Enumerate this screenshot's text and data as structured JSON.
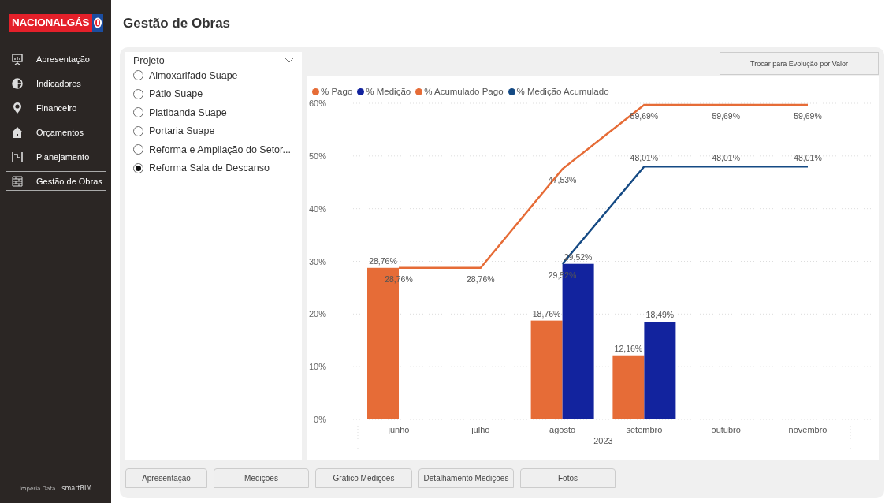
{
  "brand": {
    "name": "NACIONALGÁS"
  },
  "sidebar": {
    "items": [
      {
        "label": "Apresentação",
        "selected": false
      },
      {
        "label": "Indicadores",
        "selected": false
      },
      {
        "label": "Financeiro",
        "selected": false
      },
      {
        "label": "Orçamentos",
        "selected": false
      },
      {
        "label": "Planejamento",
        "selected": false
      },
      {
        "label": "Gestão de Obras",
        "selected": true
      }
    ],
    "footer": [
      "Imperia Data",
      "smartBIM"
    ]
  },
  "page_title": "Gestão de Obras",
  "slicer": {
    "title": "Projeto",
    "options": [
      {
        "label": "Almoxarifado Suape",
        "selected": false
      },
      {
        "label": "Pátio Suape",
        "selected": false
      },
      {
        "label": "Platibanda Suape",
        "selected": false
      },
      {
        "label": "Portaria Suape",
        "selected": false
      },
      {
        "label": "Reforma e Ampliação do Setor...",
        "selected": false
      },
      {
        "label": "Reforma Sala de Descanso",
        "selected": true
      }
    ]
  },
  "toggle_button": "Trocar para Evolução por Valor",
  "chart": {
    "chart_data": {
      "type": "bar",
      "xlabel": "2023",
      "categories": [
        "junho",
        "julho",
        "agosto",
        "setembro",
        "outubro",
        "novembro"
      ],
      "series": [
        {
          "name": "% Pago",
          "color": "#e66c37",
          "type": "bar",
          "values": [
            28.76,
            null,
            18.76,
            12.16,
            null,
            null
          ]
        },
        {
          "name": "% Medição",
          "color": "#12239e",
          "type": "bar",
          "values": [
            null,
            null,
            29.52,
            18.49,
            null,
            null
          ]
        },
        {
          "name": "% Acumulado Pago",
          "color": "#e66c37",
          "type": "line",
          "values": [
            28.76,
            28.76,
            47.53,
            59.69,
            59.69,
            59.69
          ]
        },
        {
          "name": "% Medição Acumulado",
          "color": "#154a84",
          "type": "line",
          "values": [
            null,
            null,
            29.52,
            48.01,
            48.01,
            48.01
          ]
        }
      ],
      "ylim": [
        0,
        60
      ],
      "yticks": [
        {
          "value": 0,
          "label": "0%"
        },
        {
          "value": 10,
          "label": "10%"
        },
        {
          "value": 20,
          "label": "20%"
        },
        {
          "value": 30,
          "label": "30%"
        },
        {
          "value": 40,
          "label": "40%"
        },
        {
          "value": 50,
          "label": "50%"
        },
        {
          "value": 60,
          "label": "60%"
        }
      ],
      "grid": true,
      "value_labels": [
        [
          "28,76%",
          null,
          "18,76%",
          "12,16%",
          null,
          null
        ],
        [
          null,
          null,
          "29,52%",
          "18,49%",
          null,
          null
        ],
        [
          "28,76%",
          "28,76%",
          "47,53%",
          "59,69%",
          "59,69%",
          "59,69%"
        ],
        [
          null,
          null,
          "29,52%",
          "48,01%",
          "48,01%",
          "48,01%"
        ]
      ]
    }
  },
  "tabs": [
    {
      "label": "Apresentação"
    },
    {
      "label": "Medições"
    },
    {
      "label": "Gráfico Medições"
    },
    {
      "label": "Detalhamento Medições"
    },
    {
      "label": "Fotos"
    }
  ]
}
